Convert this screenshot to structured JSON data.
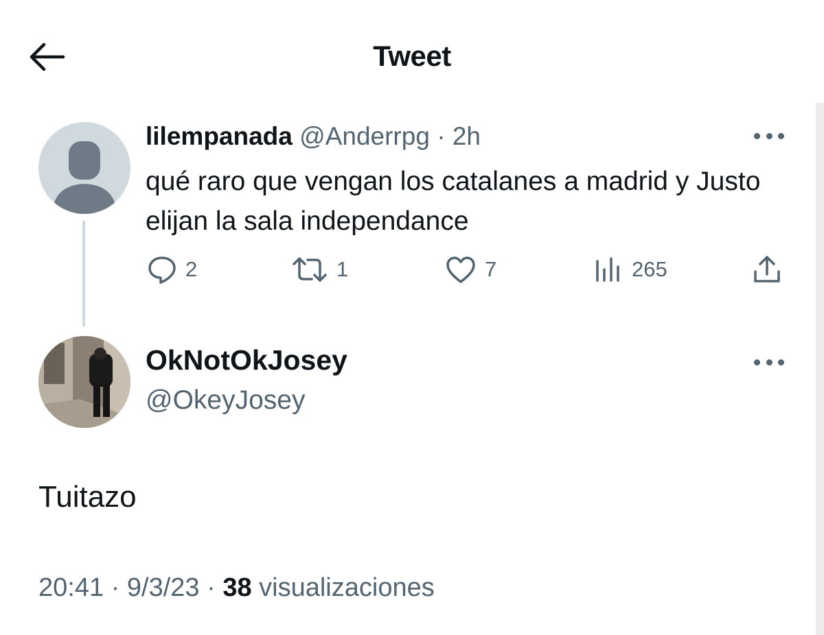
{
  "header": {
    "title": "Tweet",
    "back_icon": "arrow-left-icon"
  },
  "parent_tweet": {
    "display_name": "lilempanada",
    "handle": "@Anderrpg",
    "separator": "·",
    "time_ago": "2h",
    "text": "qué raro que vengan los catalanes a madrid y Justo elijan la sala independance",
    "actions": {
      "replies": "2",
      "retweets": "1",
      "likes": "7",
      "views": "265"
    }
  },
  "main_tweet": {
    "display_name": "OkNotOkJosey",
    "handle": "@OkeyJosey",
    "text": "Tuitazo",
    "time": "20:41",
    "separator": "·",
    "date": "9/3/23",
    "views_count": "38",
    "views_label": "visualizaciones"
  },
  "colors": {
    "text_primary": "#0f1419",
    "text_secondary": "#536471",
    "avatar_placeholder": "#cfd9de",
    "avatar_silhouette": "#6e7b86"
  }
}
